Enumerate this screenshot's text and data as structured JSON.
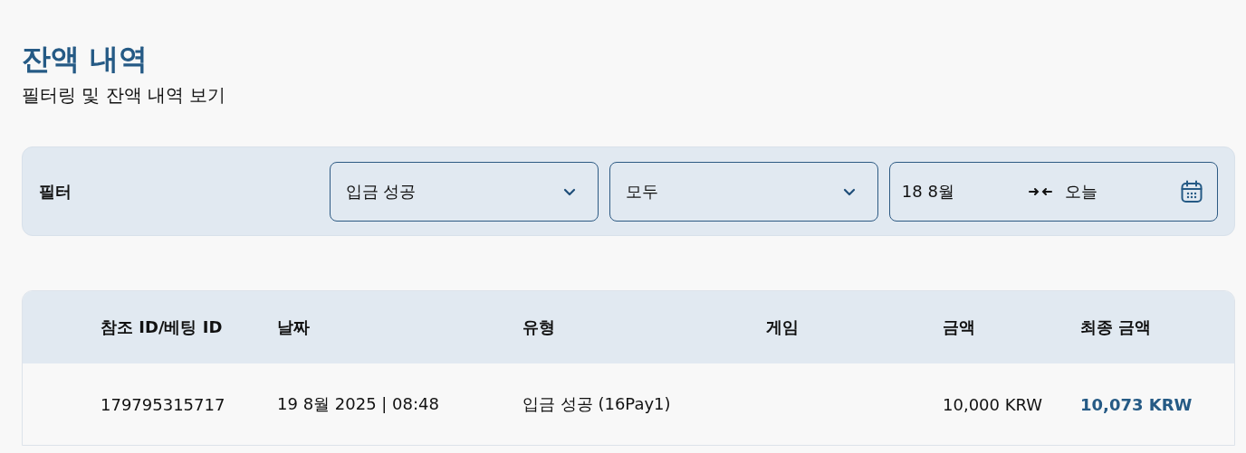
{
  "header": {
    "title": "잔액 내역",
    "subtitle": "필터링 및 잔액 내역 보기"
  },
  "filter": {
    "label": "필터",
    "dropdowns": [
      {
        "value": "입금 성공"
      },
      {
        "value": "모두"
      }
    ],
    "date_range": {
      "from": "18 8월",
      "to": "오늘"
    }
  },
  "table": {
    "columns": [
      "참조 ID/베팅 ID",
      "날짜",
      "유형",
      "게임",
      "금액",
      "최종 금액"
    ],
    "rows": [
      {
        "cells": [
          "179795315717",
          "19 8월 2025 | 08:48",
          "입금 성공 (16Pay1)",
          null,
          "10,000 KRW",
          "10,073 KRW"
        ]
      }
    ]
  }
}
